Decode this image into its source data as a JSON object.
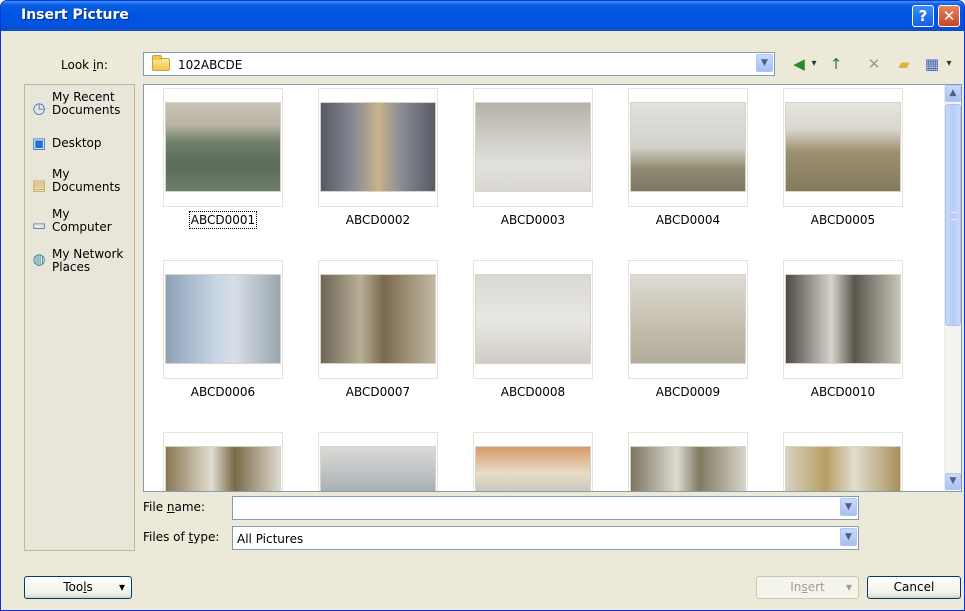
{
  "window": {
    "title": "Insert Picture",
    "help_glyph": "?",
    "close_glyph": "✕"
  },
  "lookin": {
    "label_prefix": "Look ",
    "label_accel": "i",
    "label_suffix": "n:",
    "value": "102ABCDE",
    "arrow": "▼"
  },
  "toolbar": {
    "back_glyph": "◀",
    "up_glyph": "↑",
    "delete_glyph": "✕",
    "new_folder_glyph": "▰",
    "views_glyph": "▦",
    "dropdown_glyph": "▾"
  },
  "places": [
    {
      "line1": "My Recent",
      "line2": "Documents",
      "icon": "recent-documents-icon"
    },
    {
      "line1": "Desktop",
      "line2": "",
      "icon": "desktop-icon"
    },
    {
      "line1": "My",
      "line2": "Documents",
      "icon": "my-documents-icon"
    },
    {
      "line1": "My",
      "line2": "Computer",
      "icon": "my-computer-icon"
    },
    {
      "line1": "My Network",
      "line2": "Places",
      "icon": "network-places-icon"
    }
  ],
  "files": [
    {
      "name": "ABCD0001",
      "selected": true
    },
    {
      "name": "ABCD0002"
    },
    {
      "name": "ABCD0003"
    },
    {
      "name": "ABCD0004"
    },
    {
      "name": "ABCD0005"
    },
    {
      "name": "ABCD0006"
    },
    {
      "name": "ABCD0007"
    },
    {
      "name": "ABCD0008"
    },
    {
      "name": "ABCD0009"
    },
    {
      "name": "ABCD0010"
    },
    {
      "name": ""
    },
    {
      "name": ""
    },
    {
      "name": ""
    },
    {
      "name": ""
    },
    {
      "name": ""
    }
  ],
  "scroll": {
    "up": "▲",
    "down": "▼"
  },
  "file_name": {
    "label_prefix": "File ",
    "label_accel": "n",
    "label_suffix": "ame:",
    "value": ""
  },
  "file_type": {
    "label_prefix": "Files of ",
    "label_accel": "t",
    "label_suffix": "ype:",
    "value": "All Pictures"
  },
  "buttons": {
    "tools_prefix": "Too",
    "tools_accel": "l",
    "tools_suffix": "s",
    "insert_prefix": "In",
    "insert_accel": "s",
    "insert_suffix": "ert",
    "cancel": "Cancel",
    "dropdown": "▾"
  }
}
